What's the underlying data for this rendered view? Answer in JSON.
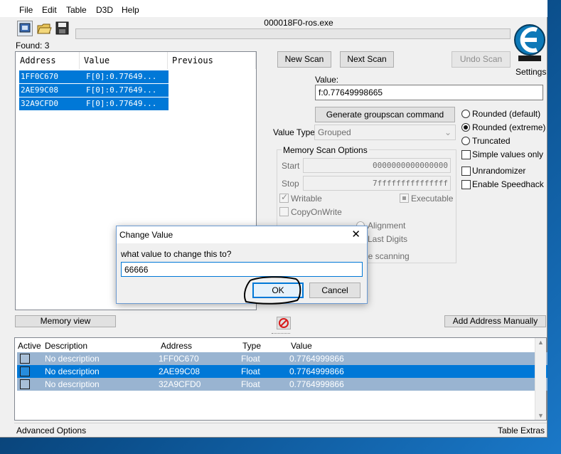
{
  "menu": [
    "File",
    "Edit",
    "Table",
    "D3D",
    "Help"
  ],
  "window": {
    "title": "000018F0-ros.exe"
  },
  "settings_label": "Settings",
  "found_label": "Found: 3",
  "scan_columns": [
    "Address",
    "Value",
    "Previous"
  ],
  "scan_results": [
    {
      "address": "1FF0C670",
      "value": "F[0]:0.77649..."
    },
    {
      "address": "2AE99C08",
      "value": "F[0]:0.77649..."
    },
    {
      "address": "32A9CFD0",
      "value": "F[0]:0.77649..."
    }
  ],
  "buttons": {
    "new_scan": "New Scan",
    "next_scan": "Next Scan",
    "undo_scan": "Undo Scan",
    "groupscan": "Generate groupscan command",
    "memory_view": "Memory view",
    "add_address": "Add Address Manually"
  },
  "value_label": "Value:",
  "value_input": "f:0.77649998665",
  "value_type_label": "Value Type",
  "value_type_selected": "Grouped",
  "radios": [
    "Rounded (default)",
    "Rounded (extreme)",
    "Truncated"
  ],
  "checkboxes": [
    "Simple values only",
    "Unrandomizer",
    "Enable Speedhack"
  ],
  "memory_scan": {
    "title": "Memory Scan Options",
    "start_label": "Start",
    "start_value": "0000000000000000",
    "stop_label": "Stop",
    "stop_value": "7fffffffffffffff",
    "writable": "Writable",
    "executable": "Executable",
    "copyonwrite": "CopyOnWrite",
    "alignment": "Alignment",
    "last_digits": "Last Digits",
    "pause_partial": "le scanning"
  },
  "dialog": {
    "title": "Change Value",
    "prompt": "what value to change this to?",
    "input": "66666",
    "ok": "OK",
    "cancel": "Cancel"
  },
  "table_columns": [
    "Active",
    "Description",
    "Address",
    "Type",
    "Value"
  ],
  "table_rows": [
    {
      "description": "No description",
      "address": "1FF0C670",
      "type": "Float",
      "value": "0.7764999866"
    },
    {
      "description": "No description",
      "address": "2AE99C08",
      "type": "Float",
      "value": "0.7764999866"
    },
    {
      "description": "No description",
      "address": "32A9CFD0",
      "type": "Float",
      "value": "0.7764999866"
    }
  ],
  "footer": {
    "left": "Advanced Options",
    "right": "Table Extras"
  },
  "colors": {
    "selection": "#0078d7",
    "row_inactive": "#99b4d1",
    "annotation": "#000000"
  }
}
